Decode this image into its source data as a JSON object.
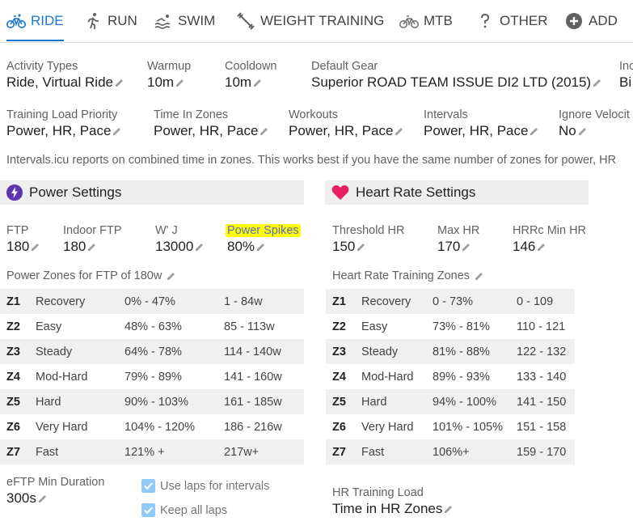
{
  "tabs": [
    {
      "label": "RIDE",
      "icon": "bike-icon"
    },
    {
      "label": "RUN",
      "icon": "run-icon"
    },
    {
      "label": "SWIM",
      "icon": "swim-icon"
    },
    {
      "label": "WEIGHT TRAINING",
      "icon": "weight-icon"
    },
    {
      "label": "MTB",
      "icon": "mtb-icon"
    },
    {
      "label": "OTHER",
      "icon": "question-icon"
    },
    {
      "label": "ADD",
      "icon": "add-circle-icon"
    }
  ],
  "active_tab": "RIDE",
  "general": {
    "activity_types": {
      "label": "Activity Types",
      "value": "Ride, Virtual Ride"
    },
    "warmup": {
      "label": "Warmup",
      "value": "10m"
    },
    "cooldown": {
      "label": "Cooldown",
      "value": "10m"
    },
    "default_gear": {
      "label": "Default Gear",
      "value": "Superior ROAD TEAM ISSUE DI2 LTD (2015)"
    },
    "cut_label": "Inc",
    "cut_value": "Bi",
    "training_load_priority": {
      "label": "Training Load Priority",
      "value": "Power, HR, Pace"
    },
    "time_in_zones": {
      "label": "Time In Zones",
      "value": "Power, HR, Pace"
    },
    "workouts": {
      "label": "Workouts",
      "value": "Power, HR, Pace"
    },
    "intervals": {
      "label": "Intervals",
      "value": "Power, HR, Pace"
    },
    "ignore_velocity": {
      "label": "Ignore Velocit",
      "value": "No"
    },
    "note": "Intervals.icu reports on combined time in zones. This works best if you have the same number of zones for power, HR"
  },
  "power": {
    "title": "Power Settings",
    "ftp": {
      "label": "FTP",
      "value": "180"
    },
    "indoor_ftp": {
      "label": "Indoor FTP",
      "value": "180"
    },
    "w_prime": {
      "label": "W' J",
      "value": "13000"
    },
    "power_spikes": {
      "label": "Power Spikes",
      "value": "80%"
    },
    "zones_title": "Power Zones for FTP of 180w",
    "zones": [
      {
        "id": "Z1",
        "name": "Recovery",
        "pct": "0% - 47%",
        "range": "1 - 84w"
      },
      {
        "id": "Z2",
        "name": "Easy",
        "pct": "48% - 63%",
        "range": "85 - 113w"
      },
      {
        "id": "Z3",
        "name": "Steady",
        "pct": "64% - 78%",
        "range": "114 - 140w"
      },
      {
        "id": "Z4",
        "name": "Mod-Hard",
        "pct": "79% - 89%",
        "range": "141 - 160w"
      },
      {
        "id": "Z5",
        "name": "Hard",
        "pct": "90% - 103%",
        "range": "161 - 185w"
      },
      {
        "id": "Z6",
        "name": "Very Hard",
        "pct": "104% - 120%",
        "range": "186 - 216w"
      },
      {
        "id": "Z7",
        "name": "Fast",
        "pct": "121% +",
        "range": "217w+"
      }
    ],
    "eftp_min_duration": {
      "label": "eFTP Min Duration",
      "value": "300s"
    },
    "use_laps": "Use laps for intervals",
    "keep_laps": "Keep all laps"
  },
  "hr": {
    "title": "Heart Rate Settings",
    "threshold": {
      "label": "Threshold HR",
      "value": "150"
    },
    "max": {
      "label": "Max HR",
      "value": "170"
    },
    "hrrc": {
      "label": "HRRc Min HR",
      "value": "146"
    },
    "zones_title": "Heart Rate Training Zones",
    "zones": [
      {
        "id": "Z1",
        "name": "Recovery",
        "pct": "0 - 73%",
        "range": "0 - 109"
      },
      {
        "id": "Z2",
        "name": "Easy",
        "pct": "73% - 81%",
        "range": "110 - 121"
      },
      {
        "id": "Z3",
        "name": "Steady",
        "pct": "81% - 88%",
        "range": "122 - 132"
      },
      {
        "id": "Z4",
        "name": "Mod-Hard",
        "pct": "89% - 93%",
        "range": "133 - 140"
      },
      {
        "id": "Z5",
        "name": "Hard",
        "pct": "94% - 100%",
        "range": "141 - 150"
      },
      {
        "id": "Z6",
        "name": "Very Hard",
        "pct": "101% - 105%",
        "range": "151 - 158"
      },
      {
        "id": "Z7",
        "name": "Fast",
        "pct": "106%+",
        "range": "159 - 170"
      }
    ],
    "training_load": {
      "label": "HR Training Load",
      "value": "Time in HR Zones"
    }
  },
  "colors": {
    "accent": "#1976d2",
    "power_icon": "#5e35b1",
    "heart": "#e91e63",
    "highlight": "#ffff00"
  }
}
